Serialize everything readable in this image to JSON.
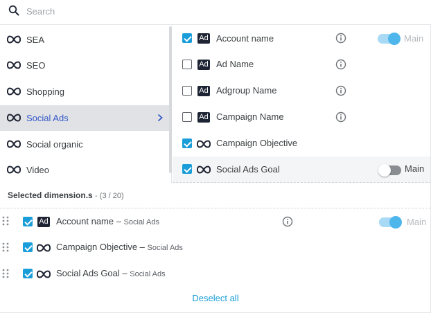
{
  "search": {
    "placeholder": "Search",
    "icon": "search-icon"
  },
  "categories": [
    {
      "label": "SEA",
      "icon": "infinity-icon",
      "active": false
    },
    {
      "label": "SEO",
      "icon": "infinity-icon",
      "active": false
    },
    {
      "label": "Shopping",
      "icon": "infinity-icon",
      "active": false
    },
    {
      "label": "Social Ads",
      "icon": "infinity-icon",
      "active": true
    },
    {
      "label": "Social organic",
      "icon": "infinity-icon",
      "active": false
    },
    {
      "label": "Video",
      "icon": "infinity-icon",
      "active": false
    }
  ],
  "dimensions": [
    {
      "label": "Account name",
      "badge": "Ad",
      "checked": true,
      "info": true,
      "toggle": "on",
      "toggle_label": "Main"
    },
    {
      "label": "Ad Name",
      "badge": "Ad",
      "checked": false,
      "info": true
    },
    {
      "label": "Adgroup Name",
      "badge": "Ad",
      "checked": false,
      "info": true
    },
    {
      "label": "Campaign Name",
      "badge": "Ad",
      "checked": false,
      "info": true
    },
    {
      "label": "Campaign Objective",
      "badge": "",
      "checked": true,
      "info": false
    },
    {
      "label": "Social Ads Goal",
      "badge": "",
      "checked": true,
      "info": false,
      "toggle": "off",
      "toggle_label": "Main"
    }
  ],
  "selected": {
    "title": "Selected dimension.s",
    "count": "(3 / 20)",
    "items": [
      {
        "label": "Account name",
        "source": "Social Ads",
        "badge": "Ad",
        "info": true,
        "toggle_label": "Main"
      },
      {
        "label": "Campaign Objective",
        "source": "Social Ads",
        "badge": ""
      },
      {
        "label": "Social Ads Goal",
        "source": "Social Ads",
        "badge": ""
      }
    ]
  },
  "deselect_all": "Deselect all",
  "colors": {
    "accent": "#1a9ed9",
    "active_text": "#3558c9",
    "active_bg": "#e0e2e5",
    "badge_bg": "#1e2433"
  }
}
